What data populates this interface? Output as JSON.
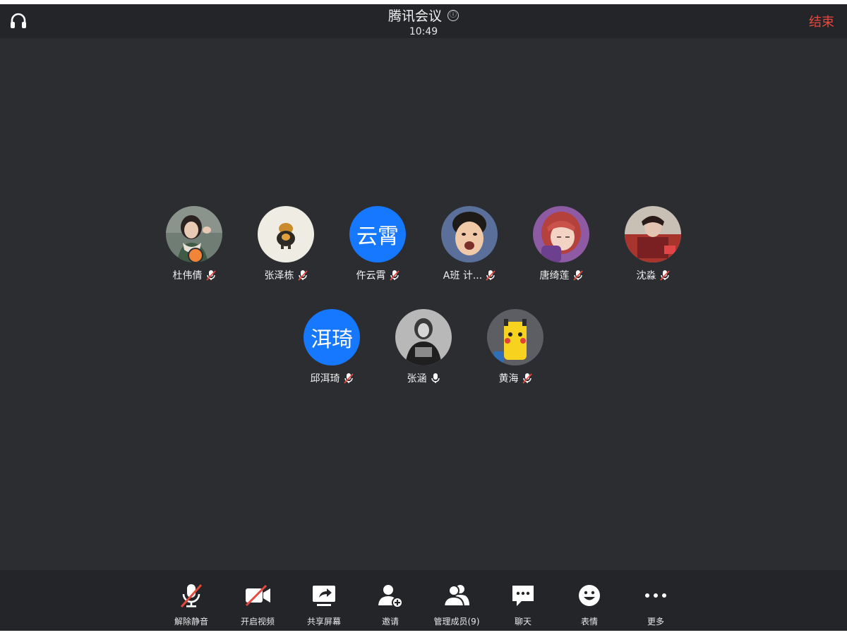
{
  "header": {
    "title": "腾讯会议",
    "info_icon": "ⓘ",
    "time": "10:49",
    "end_label": "结束",
    "end_color": "#e5483f"
  },
  "participants": {
    "row1": [
      {
        "name": "杜伟倩",
        "avatar_text": "",
        "avatar": "photo-girl-scarf",
        "mic": "muted-icon"
      },
      {
        "name": "张泽栋",
        "avatar_text": "",
        "avatar": "photo-cartoon-dog",
        "mic": "muted-icon"
      },
      {
        "name": "仵云霄",
        "avatar_text": "云霄",
        "avatar": "initials-blue",
        "mic": "muted-icon"
      },
      {
        "name": "A班 计...",
        "avatar_text": "",
        "avatar": "photo-child-face",
        "mic": "muted-icon"
      },
      {
        "name": "唐绮莲",
        "avatar_text": "",
        "avatar": "cartoon-girl-red-hair",
        "mic": "muted-icon"
      },
      {
        "name": "沈淼",
        "avatar_text": "",
        "avatar": "photo-opera-costume",
        "mic": "muted-icon"
      }
    ],
    "row2": [
      {
        "name": "邱洱琦",
        "avatar_text": "洱琦",
        "avatar": "initials-blue",
        "mic": "muted-icon"
      },
      {
        "name": "张涵",
        "avatar_text": "",
        "avatar": "photo-grayscale-reader",
        "mic": "microphone-icon"
      },
      {
        "name": "黄海",
        "avatar_text": "",
        "avatar": "photo-pikachu-cup",
        "mic": "muted-icon"
      }
    ]
  },
  "toolbar": {
    "unmute": "解除静音",
    "start_video": "开启视频",
    "share_screen": "共享屏幕",
    "invite": "邀请",
    "manage_members": "管理成员(9)",
    "chat": "聊天",
    "emoji": "表情",
    "more": "更多"
  },
  "colors": {
    "background": "#2b2d31",
    "bar": "#232528",
    "initials_blue": "#1677ff",
    "muted_red": "#e5483f"
  }
}
